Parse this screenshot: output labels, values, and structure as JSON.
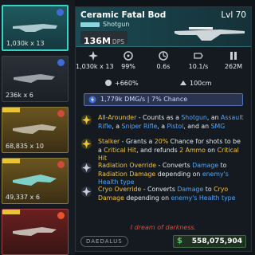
{
  "inventory": {
    "cards": [
      {
        "stat": "1,030k x 13",
        "rarity": "legendary-cyan",
        "element": "blue"
      },
      {
        "stat": "236k x 6",
        "rarity": "common",
        "element": "blue"
      },
      {
        "stat": "68,835 x 10",
        "rarity": "epic-gold",
        "element": "red"
      },
      {
        "stat": "49,337 x 6",
        "rarity": "epic-gold",
        "element": "red"
      },
      {
        "stat": "",
        "rarity": "red",
        "element": "fire"
      }
    ]
  },
  "weapon": {
    "name": "Ceramic Fatal Bod",
    "level": "Lvl 70",
    "type": "Shotgun",
    "dps_value": "136M",
    "dps_unit": "DPS"
  },
  "stats": [
    {
      "icon": "damage-icon",
      "value": "1,030k x 13"
    },
    {
      "icon": "accuracy-icon",
      "value": "99%"
    },
    {
      "icon": "reload-icon",
      "value": "0.6s"
    },
    {
      "icon": "firerate-icon",
      "value": "10.1/s"
    },
    {
      "icon": "magazine-icon",
      "value": "262M"
    }
  ],
  "modifiers": [
    {
      "icon": "crit-icon",
      "value": "+660%"
    },
    {
      "icon": "range-icon",
      "value": "100cm"
    }
  ],
  "element_bar": {
    "text": "1,779k DMG/s | 7% Chance",
    "color": "#5770b5"
  },
  "perks": [
    {
      "icon": "all-arounder-icon",
      "title": "All-Arounder",
      "parts": [
        {
          "t": " - Counts as a ",
          "c": "w"
        },
        {
          "t": "Shotgun",
          "c": "b"
        },
        {
          "t": ", an ",
          "c": "w"
        },
        {
          "t": "Assault Rifle",
          "c": "b"
        },
        {
          "t": ", a ",
          "c": "w"
        },
        {
          "t": "Sniper Rifle",
          "c": "b"
        },
        {
          "t": ", a ",
          "c": "w"
        },
        {
          "t": "Pistol",
          "c": "b"
        },
        {
          "t": ", and an ",
          "c": "w"
        },
        {
          "t": "SMG",
          "c": "b"
        }
      ]
    },
    {
      "icon": "stalker-icon",
      "title": "Stalker",
      "parts": [
        {
          "t": " - Grants a ",
          "c": "w"
        },
        {
          "t": "20%",
          "c": "y"
        },
        {
          "t": " Chance for shots to be a ",
          "c": "w"
        },
        {
          "t": "Critical Hit",
          "c": "y"
        },
        {
          "t": ", and refunds ",
          "c": "w"
        },
        {
          "t": "2 Ammo",
          "c": "y"
        },
        {
          "t": " on ",
          "c": "w"
        },
        {
          "t": "Critical Hit",
          "c": "y"
        }
      ]
    },
    {
      "icon": "radiation-override-icon",
      "title": "Radiation Override",
      "parts": [
        {
          "t": " - Converts ",
          "c": "w"
        },
        {
          "t": "Damage",
          "c": "b"
        },
        {
          "t": " to ",
          "c": "w"
        },
        {
          "t": "Radiation Damage",
          "c": "y"
        },
        {
          "t": " depending on ",
          "c": "w"
        },
        {
          "t": "enemy's Health type",
          "c": "b"
        }
      ]
    },
    {
      "icon": "cryo-override-icon",
      "title": "Cryo Override",
      "parts": [
        {
          "t": " - Converts ",
          "c": "w"
        },
        {
          "t": "Damage",
          "c": "b"
        },
        {
          "t": " to ",
          "c": "w"
        },
        {
          "t": "Cryo Damage",
          "c": "y"
        },
        {
          "t": " depending on ",
          "c": "w"
        },
        {
          "t": "enemy's Health type",
          "c": "b"
        }
      ]
    }
  ],
  "flavor": "I dream of darkness.",
  "brand": "DAEDALUS",
  "price": {
    "currency": "$",
    "value": "558,075,904"
  },
  "colors": {
    "accent": "#39d3c6",
    "gold": "#f2c43d",
    "blue": "#4fa8ff",
    "red": "#e14a3e"
  }
}
